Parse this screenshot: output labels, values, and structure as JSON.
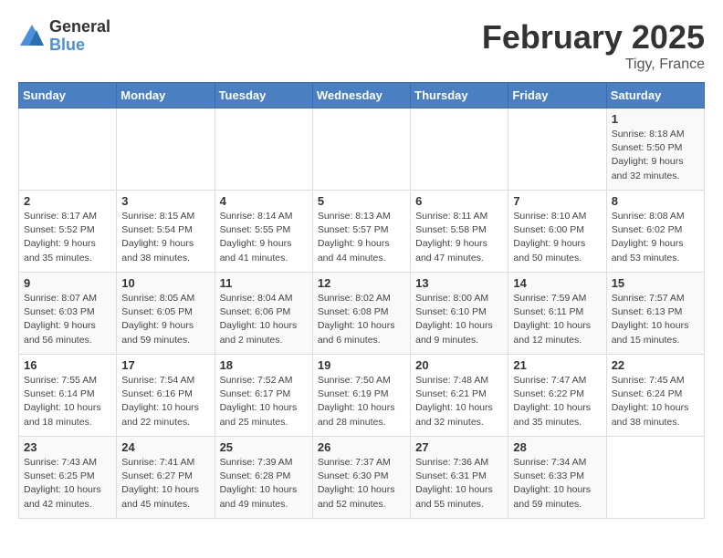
{
  "logo": {
    "general": "General",
    "blue": "Blue"
  },
  "title": "February 2025",
  "location": "Tigy, France",
  "days_of_week": [
    "Sunday",
    "Monday",
    "Tuesday",
    "Wednesday",
    "Thursday",
    "Friday",
    "Saturday"
  ],
  "weeks": [
    [
      {
        "day": "",
        "info": ""
      },
      {
        "day": "",
        "info": ""
      },
      {
        "day": "",
        "info": ""
      },
      {
        "day": "",
        "info": ""
      },
      {
        "day": "",
        "info": ""
      },
      {
        "day": "",
        "info": ""
      },
      {
        "day": "1",
        "info": "Sunrise: 8:18 AM\nSunset: 5:50 PM\nDaylight: 9 hours and 32 minutes."
      }
    ],
    [
      {
        "day": "2",
        "info": "Sunrise: 8:17 AM\nSunset: 5:52 PM\nDaylight: 9 hours and 35 minutes."
      },
      {
        "day": "3",
        "info": "Sunrise: 8:15 AM\nSunset: 5:54 PM\nDaylight: 9 hours and 38 minutes."
      },
      {
        "day": "4",
        "info": "Sunrise: 8:14 AM\nSunset: 5:55 PM\nDaylight: 9 hours and 41 minutes."
      },
      {
        "day": "5",
        "info": "Sunrise: 8:13 AM\nSunset: 5:57 PM\nDaylight: 9 hours and 44 minutes."
      },
      {
        "day": "6",
        "info": "Sunrise: 8:11 AM\nSunset: 5:58 PM\nDaylight: 9 hours and 47 minutes."
      },
      {
        "day": "7",
        "info": "Sunrise: 8:10 AM\nSunset: 6:00 PM\nDaylight: 9 hours and 50 minutes."
      },
      {
        "day": "8",
        "info": "Sunrise: 8:08 AM\nSunset: 6:02 PM\nDaylight: 9 hours and 53 minutes."
      }
    ],
    [
      {
        "day": "9",
        "info": "Sunrise: 8:07 AM\nSunset: 6:03 PM\nDaylight: 9 hours and 56 minutes."
      },
      {
        "day": "10",
        "info": "Sunrise: 8:05 AM\nSunset: 6:05 PM\nDaylight: 9 hours and 59 minutes."
      },
      {
        "day": "11",
        "info": "Sunrise: 8:04 AM\nSunset: 6:06 PM\nDaylight: 10 hours and 2 minutes."
      },
      {
        "day": "12",
        "info": "Sunrise: 8:02 AM\nSunset: 6:08 PM\nDaylight: 10 hours and 6 minutes."
      },
      {
        "day": "13",
        "info": "Sunrise: 8:00 AM\nSunset: 6:10 PM\nDaylight: 10 hours and 9 minutes."
      },
      {
        "day": "14",
        "info": "Sunrise: 7:59 AM\nSunset: 6:11 PM\nDaylight: 10 hours and 12 minutes."
      },
      {
        "day": "15",
        "info": "Sunrise: 7:57 AM\nSunset: 6:13 PM\nDaylight: 10 hours and 15 minutes."
      }
    ],
    [
      {
        "day": "16",
        "info": "Sunrise: 7:55 AM\nSunset: 6:14 PM\nDaylight: 10 hours and 18 minutes."
      },
      {
        "day": "17",
        "info": "Sunrise: 7:54 AM\nSunset: 6:16 PM\nDaylight: 10 hours and 22 minutes."
      },
      {
        "day": "18",
        "info": "Sunrise: 7:52 AM\nSunset: 6:17 PM\nDaylight: 10 hours and 25 minutes."
      },
      {
        "day": "19",
        "info": "Sunrise: 7:50 AM\nSunset: 6:19 PM\nDaylight: 10 hours and 28 minutes."
      },
      {
        "day": "20",
        "info": "Sunrise: 7:48 AM\nSunset: 6:21 PM\nDaylight: 10 hours and 32 minutes."
      },
      {
        "day": "21",
        "info": "Sunrise: 7:47 AM\nSunset: 6:22 PM\nDaylight: 10 hours and 35 minutes."
      },
      {
        "day": "22",
        "info": "Sunrise: 7:45 AM\nSunset: 6:24 PM\nDaylight: 10 hours and 38 minutes."
      }
    ],
    [
      {
        "day": "23",
        "info": "Sunrise: 7:43 AM\nSunset: 6:25 PM\nDaylight: 10 hours and 42 minutes."
      },
      {
        "day": "24",
        "info": "Sunrise: 7:41 AM\nSunset: 6:27 PM\nDaylight: 10 hours and 45 minutes."
      },
      {
        "day": "25",
        "info": "Sunrise: 7:39 AM\nSunset: 6:28 PM\nDaylight: 10 hours and 49 minutes."
      },
      {
        "day": "26",
        "info": "Sunrise: 7:37 AM\nSunset: 6:30 PM\nDaylight: 10 hours and 52 minutes."
      },
      {
        "day": "27",
        "info": "Sunrise: 7:36 AM\nSunset: 6:31 PM\nDaylight: 10 hours and 55 minutes."
      },
      {
        "day": "28",
        "info": "Sunrise: 7:34 AM\nSunset: 6:33 PM\nDaylight: 10 hours and 59 minutes."
      },
      {
        "day": "",
        "info": ""
      }
    ]
  ]
}
